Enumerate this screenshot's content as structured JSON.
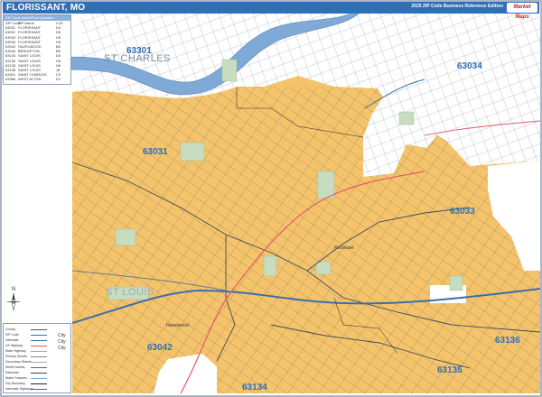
{
  "header": {
    "title": "FLORISSANT, MO",
    "edition": "2025 ZIP Code Business Reference Edition",
    "logo_text": "Market Maps"
  },
  "zip_legend": {
    "header": "ZIP Code Index/Post Location",
    "columns": [
      "ZIP Code",
      "ZIP Name",
      "LOC"
    ],
    "rows": [
      [
        "63031",
        "FLORISSANT",
        "D4"
      ],
      [
        "63032",
        "FLORISSANT",
        "D5"
      ],
      [
        "63033",
        "FLORISSANT",
        "H5"
      ],
      [
        "63034",
        "FLORISSANT",
        "H3"
      ],
      [
        "63042",
        "HAZELWOOD",
        "B6"
      ],
      [
        "63044",
        "BRIDGETON",
        "B5"
      ],
      [
        "63134",
        "SAINT LOUIS",
        "D6"
      ],
      [
        "63135",
        "SAINT LOUIS",
        "G6"
      ],
      [
        "63136",
        "SAINT LOUIS",
        "H6"
      ],
      [
        "63138",
        "SAINT LOUIS",
        "J5"
      ],
      [
        "63301",
        "SAINT CHARLES",
        "C4"
      ],
      [
        "63386",
        "WEST ALTON",
        "D1"
      ]
    ]
  },
  "map_legend": {
    "rows": [
      "County",
      "ZIP Code",
      "Interstate",
      "US Highway",
      "State Highway",
      "Primary Streets",
      "Secondary Streets",
      "Street Names",
      "Railroads",
      "Water Features",
      "City Boundary",
      "Interstate Highways"
    ],
    "city_words": [
      "City",
      "City",
      "City"
    ]
  },
  "zip_labels": [
    "63301",
    "63034",
    "63031",
    "63033",
    "63042",
    "63134",
    "63135",
    "63136"
  ],
  "place_labels": {
    "st_charles": "ST CHARLES",
    "st_louis": "ST LOUIS",
    "florissant": "Florissant",
    "hazelwood": "Hazelwood"
  },
  "colors": {
    "zip_fill": "#f5c46a",
    "river": "#7fa9d6",
    "title_bar": "#2f6fb8",
    "zip_label": "#2f6fb8",
    "park": "#c8dcc0",
    "highway_red": "#e05a6a",
    "highway_blue": "#3a6fa8"
  }
}
